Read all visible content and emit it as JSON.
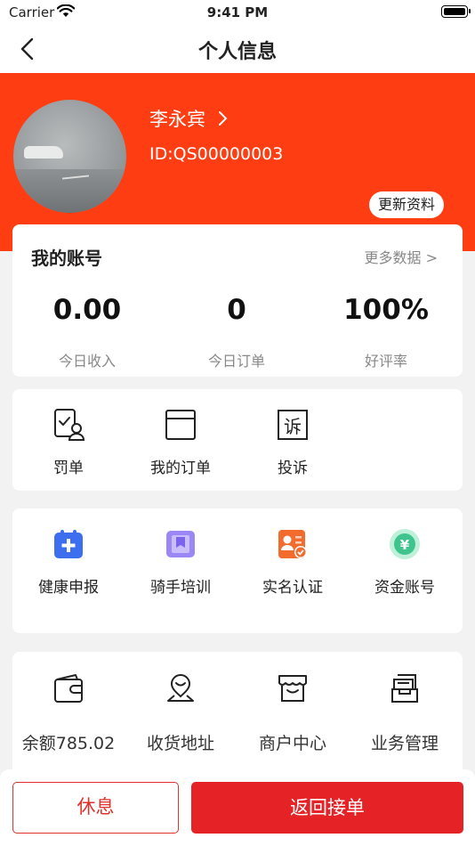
{
  "status_bar": {
    "carrier": "Carrier",
    "time": "9:41 PM"
  },
  "nav": {
    "title": "个人信息"
  },
  "profile": {
    "name": "李永宾",
    "id": "ID:QS00000003",
    "update_label": "更新资料"
  },
  "account": {
    "title": "我的账号",
    "more_label": "更多数据 >",
    "stats": [
      {
        "value": "0.00",
        "label": "今日收入"
      },
      {
        "value": "0",
        "label": "今日订单"
      },
      {
        "value": "100%",
        "label": "好评率"
      }
    ]
  },
  "menu1": [
    {
      "label": "罚单",
      "icon": "penalty-icon"
    },
    {
      "label": "我的订单",
      "icon": "orders-icon"
    },
    {
      "label": "投诉",
      "icon": "complaint-icon"
    }
  ],
  "menu2": [
    {
      "label": "健康申报",
      "icon": "health-icon"
    },
    {
      "label": "骑手培训",
      "icon": "training-icon"
    },
    {
      "label": "实名认证",
      "icon": "id-verify-icon"
    },
    {
      "label": "资金账号",
      "icon": "fund-icon"
    }
  ],
  "menu3": [
    {
      "label": "余额785.02",
      "icon": "wallet-icon"
    },
    {
      "label": "收货地址",
      "icon": "address-icon"
    },
    {
      "label": "商户中心",
      "icon": "store-icon"
    },
    {
      "label": "业务管理",
      "icon": "business-icon"
    }
  ],
  "bottom": {
    "rest_label": "休息",
    "return_label": "返回接单"
  },
  "colors": {
    "brand_orange": "#ff3d12",
    "button_red": "#e52226",
    "health_blue": "#3d6ef0",
    "training_purple": "#9b87f5",
    "verify_orange": "#f46b2e",
    "fund_green": "#3ec48c"
  }
}
